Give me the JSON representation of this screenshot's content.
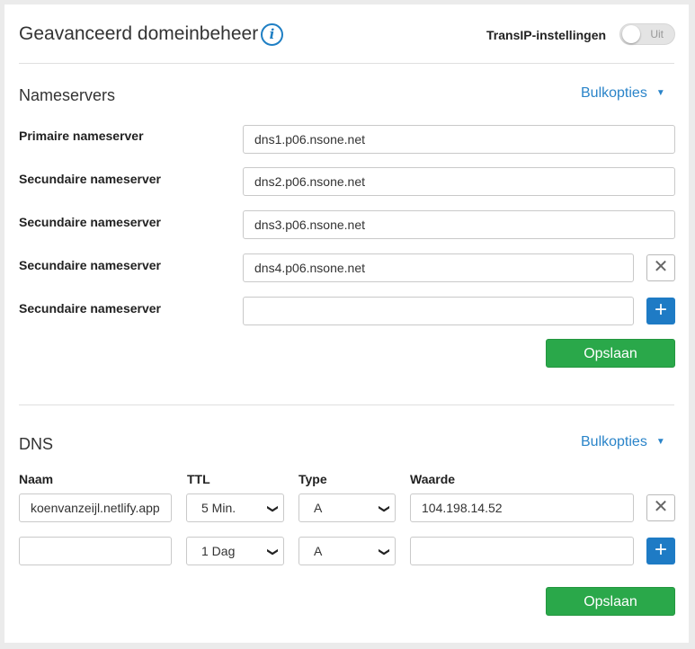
{
  "header": {
    "title": "Geavanceerd domeinbeheer",
    "info_glyph": "i",
    "transip_label": "TransIP-instellingen",
    "toggle_text": "Uit"
  },
  "nameservers": {
    "title": "Nameservers",
    "bulk_label": "Bulkopties",
    "rows": [
      {
        "label": "Primaire nameserver",
        "value": "dns1.p06.nsone.net"
      },
      {
        "label": "Secundaire nameserver",
        "value": "dns2.p06.nsone.net"
      },
      {
        "label": "Secundaire nameserver",
        "value": "dns3.p06.nsone.net"
      },
      {
        "label": "Secundaire nameserver",
        "value": "dns4.p06.nsone.net"
      },
      {
        "label": "Secundaire nameserver",
        "value": ""
      }
    ],
    "save_label": "Opslaan"
  },
  "dns": {
    "title": "DNS",
    "bulk_label": "Bulkopties",
    "columns": {
      "name": "Naam",
      "ttl": "TTL",
      "type": "Type",
      "value": "Waarde"
    },
    "records": [
      {
        "name": "koenvanzeijl.netlify.app",
        "ttl": "5 Min.",
        "type": "A",
        "value": "104.198.14.52"
      },
      {
        "name": "",
        "ttl": "1 Dag",
        "type": "A",
        "value": ""
      }
    ],
    "save_label": "Opslaan"
  },
  "icons": {
    "remove": "close-icon",
    "add": "plus-icon",
    "dropdown": "chevron-down-icon",
    "caret": "caret-down-icon"
  },
  "colors": {
    "accent": "#1e7bc5",
    "link": "#2a84c9",
    "save": "#2aa84a"
  }
}
